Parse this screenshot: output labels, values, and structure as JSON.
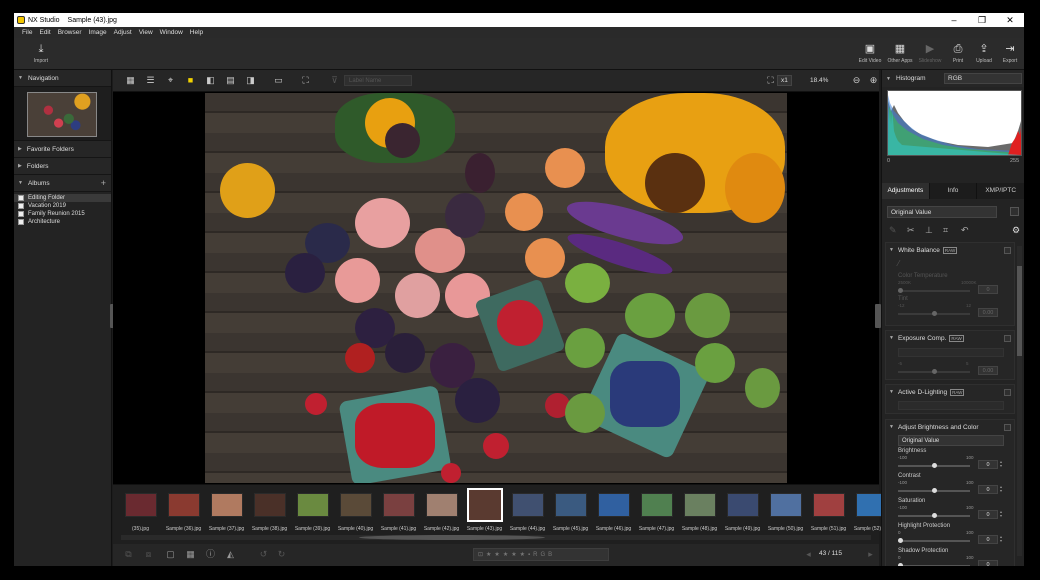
{
  "titlebar": {
    "app": "NX Studio",
    "file": "Sample (43).jpg",
    "minimize": "–",
    "maximize": "❐",
    "close": "✕"
  },
  "menu": [
    "File",
    "Edit",
    "Browser",
    "Image",
    "Adjust",
    "View",
    "Window",
    "Help"
  ],
  "toolbar": {
    "import": "Import",
    "edit_video": "Edit Video",
    "other_apps": "Other Apps",
    "slideshow": "Slideshow",
    "print": "Print",
    "upload": "Upload",
    "export": "Export"
  },
  "left": {
    "navigation": "Navigation",
    "favorite_folders": "Favorite Folders",
    "folders": "Folders",
    "albums": "Albums",
    "album_items": [
      "Editing Folder",
      "Vacation 2019",
      "Family Reunion 2015",
      "Architecture"
    ]
  },
  "center": {
    "filter_placeholder": "Label Name",
    "zoom_fit": "x1",
    "zoom_value": "18.4%"
  },
  "filmstrip": {
    "labels": [
      "(35).jpg",
      "Sample (36).jpg",
      "Sample (37).jpg",
      "Sample (38).jpg",
      "Sample (39).jpg",
      "Sample (40).jpg",
      "Sample (41).jpg",
      "Sample (42).jpg",
      "Sample (43).jpg",
      "Sample (44).jpg",
      "Sample (45).jpg",
      "Sample (46).jpg",
      "Sample (47).jpg",
      "Sample (48).jpg",
      "Sample (49).jpg",
      "Sample (50).jpg",
      "Sample (51).jpg",
      "Sample (52).jpg"
    ],
    "colors": [
      "#6a2a30",
      "#8a3a30",
      "#b07a60",
      "#4a3028",
      "#6a8a40",
      "#5a4a38",
      "#7a4040",
      "#a08070",
      "#5a3a30",
      "#405070",
      "#3a5a80",
      "#3060a0",
      "#508050",
      "#6a8060",
      "#3a4a70",
      "#5070a0",
      "#a04040",
      "#3070b0"
    ]
  },
  "bottom": {
    "counter": "43 / 115",
    "rating_labels": [
      "R",
      "G",
      "B"
    ]
  },
  "right": {
    "histogram": "Histogram",
    "hist_channel": "RGB",
    "hist_min": "0",
    "hist_max": "255",
    "tabs": [
      "Adjustments",
      "Info",
      "XMP/IPTC"
    ],
    "preset": "Original Value",
    "white_balance": {
      "title": "White Balance",
      "badge": "RAW",
      "color_temp_label": "Color Temperature",
      "color_temp_min": "2500K",
      "color_temp_max": "10000K",
      "color_temp_value": "0",
      "tint_label": "Tint",
      "tint_min": "-12",
      "tint_max": "12",
      "tint_value": "0.00"
    },
    "exposure": {
      "title": "Exposure Comp.",
      "badge": "RAW",
      "min": "-5",
      "max": "5",
      "value": "0.00"
    },
    "adl": {
      "title": "Active D-Lighting",
      "badge": "RAW"
    },
    "abc": {
      "title": "Adjust Brightness and Color",
      "preset": "Original Value",
      "brightness_label": "Brightness",
      "brightness_min": "-100",
      "brightness_max": "100",
      "brightness_value": "0",
      "contrast_label": "Contrast",
      "contrast_min": "-100",
      "contrast_max": "100",
      "contrast_value": "0",
      "saturation_label": "Saturation",
      "saturation_min": "-100",
      "saturation_max": "100",
      "saturation_value": "0",
      "highlight_label": "Highlight Protection",
      "highlight_min": "0",
      "highlight_max": "100",
      "highlight_value": "0",
      "shadow_label": "Shadow Protection",
      "shadow_min": "0",
      "shadow_max": "100",
      "shadow_value": "0"
    }
  },
  "accent": "#f2d200"
}
